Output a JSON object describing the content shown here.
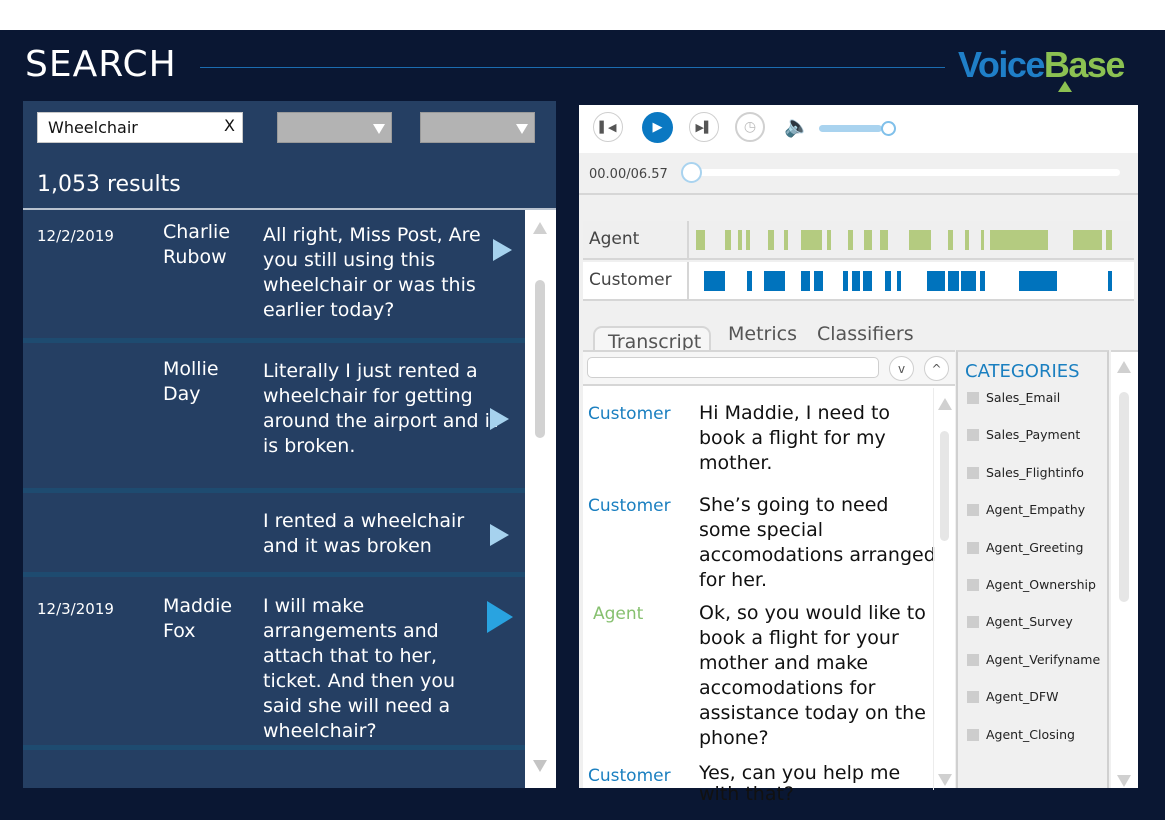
{
  "header": {
    "title": "SEARCH",
    "logo_part1": "Voice",
    "logo_part2": "Base"
  },
  "search": {
    "query": "Wheelchair",
    "clear_label": "X",
    "filter1_value": "",
    "filter2_value": "",
    "result_count": "1,053 results"
  },
  "results": [
    {
      "date": "12/2/2019",
      "name": "Charlie Rubow",
      "text": "All right, Miss Post, Are you still using this wheelchair or was this earlier today?",
      "playing": false
    },
    {
      "date": "",
      "name": "Mollie Day",
      "text": "Literally I just rented a wheelchair for getting around the airport and it is broken.",
      "playing": false
    },
    {
      "date": "",
      "name": "",
      "text": "I rented a wheelchair and it was broken",
      "playing": false
    },
    {
      "date": "12/3/2019",
      "name": "Maddie Fox",
      "text": "I will make arrangements and attach that to her, ticket. And then you said she will need a wheelchair?",
      "playing": true
    }
  ],
  "player": {
    "current_time": "00.00",
    "duration": "06.57",
    "time_readout": "00.00/06.57",
    "progress": 0.0,
    "volume": 1.0,
    "icons": {
      "prev": "skip-back-icon",
      "play": "play-icon",
      "next": "skip-forward-icon",
      "history": "clock-icon",
      "volume": "speaker-icon"
    }
  },
  "tracks": {
    "agent_label": "Agent",
    "customer_label": "Customer",
    "agent_segments": [
      [
        0.016,
        0.036
      ],
      [
        0.081,
        0.095
      ],
      [
        0.11,
        0.119
      ],
      [
        0.128,
        0.137
      ],
      [
        0.176,
        0.191
      ],
      [
        0.212,
        0.221
      ],
      [
        0.25,
        0.297
      ],
      [
        0.309,
        0.318
      ],
      [
        0.356,
        0.367
      ],
      [
        0.392,
        0.41
      ],
      [
        0.428,
        0.446
      ],
      [
        0.493,
        0.541
      ],
      [
        0.579,
        0.59
      ],
      [
        0.617,
        0.626
      ],
      [
        0.653,
        0.66
      ],
      [
        0.673,
        0.804
      ],
      [
        0.86,
        0.923
      ],
      [
        0.934,
        0.946
      ]
    ],
    "customer_segments": [
      [
        0.034,
        0.081
      ],
      [
        0.129,
        0.14
      ],
      [
        0.167,
        0.214
      ],
      [
        0.25,
        0.27
      ],
      [
        0.279,
        0.3
      ],
      [
        0.345,
        0.356
      ],
      [
        0.365,
        0.383
      ],
      [
        0.39,
        0.41
      ],
      [
        0.439,
        0.453
      ],
      [
        0.466,
        0.475
      ],
      [
        0.532,
        0.572
      ],
      [
        0.579,
        0.604
      ],
      [
        0.608,
        0.642
      ],
      [
        0.651,
        0.662
      ],
      [
        0.739,
        0.824
      ],
      [
        0.937,
        0.946
      ]
    ]
  },
  "tabs": [
    {
      "label": "Transcript",
      "active": true
    },
    {
      "label": "Metrics",
      "active": false
    },
    {
      "label": "Classifiers",
      "active": false
    }
  ],
  "transcript": {
    "search_value": "",
    "next_label": "v",
    "prev_label": "^",
    "utterances": [
      {
        "speaker": "Customer",
        "role": "customer",
        "text": "Hi Maddie, I need to book a flight for my mother."
      },
      {
        "speaker": "Customer",
        "role": "customer",
        "text": "She’s going to need some special accomodations arranged for her."
      },
      {
        "speaker": "Agent",
        "role": "agent",
        "text": "Ok, so you would like to book a flight for your mother and make accomodations for assistance today on the phone?"
      },
      {
        "speaker": "Customer",
        "role": "customer",
        "text": "Yes, can you help me with that?"
      }
    ]
  },
  "categories": {
    "title": "CATEGORIES",
    "items": [
      {
        "label": "Sales_Email",
        "checked": false
      },
      {
        "label": "Sales_Payment",
        "checked": false
      },
      {
        "label": "Sales_Flightinfo",
        "checked": false
      },
      {
        "label": "Agent_Empathy",
        "checked": false
      },
      {
        "label": "Agent_Greeting",
        "checked": false
      },
      {
        "label": "Agent_Ownership",
        "checked": false
      },
      {
        "label": "Agent_Survey",
        "checked": false
      },
      {
        "label": "Agent_Verifyname",
        "checked": false
      },
      {
        "label": "Agent_DFW",
        "checked": false
      },
      {
        "label": "Agent_Closing",
        "checked": false
      }
    ]
  },
  "colors": {
    "background": "#0a1733",
    "panel": "#253f63",
    "accent_blue": "#0a78c2",
    "agent_green": "#b4cb80",
    "customer_blue": "#0073bd",
    "logo_blue": "#1f7fc8",
    "logo_green": "#8cc152"
  }
}
